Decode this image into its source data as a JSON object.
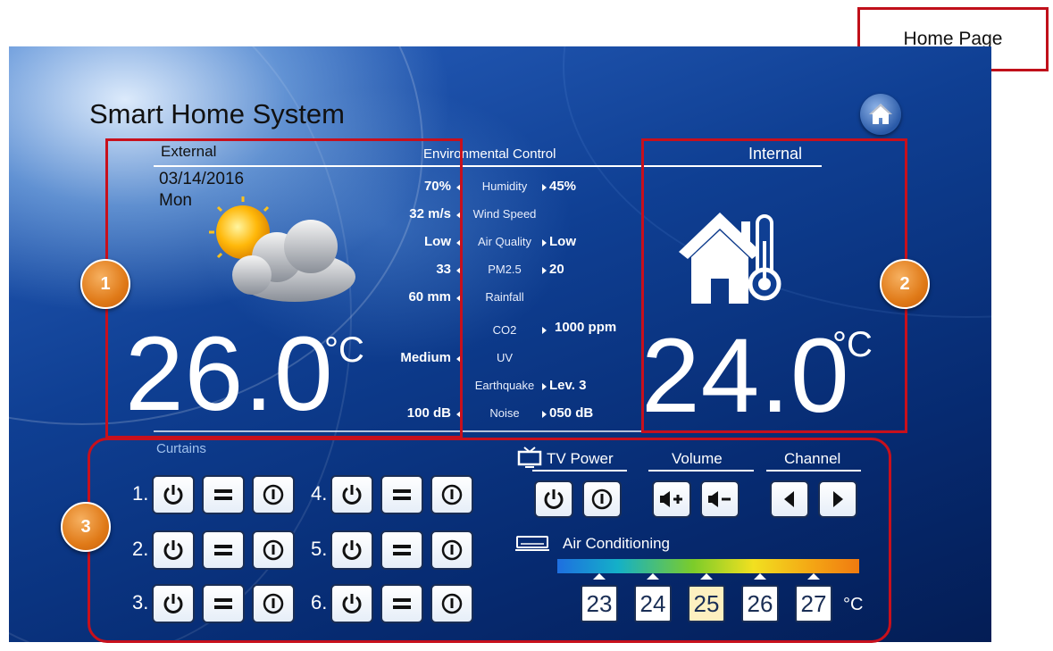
{
  "app": {
    "title": "Smart Home System"
  },
  "callout": {
    "label": "Home Page"
  },
  "external": {
    "label": "External",
    "date": "03/14/2016",
    "day": "Mon",
    "temp": "26.0",
    "unit": "°C"
  },
  "internal": {
    "label": "Internal",
    "temp": "24.0",
    "unit": "°C"
  },
  "environment": {
    "title": "Environmental Control",
    "rows": [
      {
        "label": "Humidity",
        "ext": "70%",
        "int": "45%"
      },
      {
        "label": "Wind Speed",
        "ext": "32 m/s",
        "int": ""
      },
      {
        "label": "Air Quality",
        "ext": "Low",
        "int": "Low"
      },
      {
        "label": "PM2.5",
        "ext": "33",
        "int": "20"
      },
      {
        "label": "Rainfall",
        "ext": "60 mm",
        "int": ""
      },
      {
        "label": "CO2",
        "ext": "",
        "int": "1000 ppm"
      },
      {
        "label": "UV",
        "ext": "Medium",
        "int": ""
      },
      {
        "label": "Earthquake",
        "ext": "",
        "int": "Lev. 3"
      },
      {
        "label": "Noise",
        "ext": "100 dB",
        "int": "050 dB"
      }
    ]
  },
  "badges": [
    "1",
    "2",
    "3"
  ],
  "curtains": {
    "title": "Curtains",
    "numbers": [
      "1.",
      "2.",
      "3.",
      "4.",
      "5.",
      "6."
    ]
  },
  "tv": {
    "power_label": "TV Power",
    "volume_label": "Volume",
    "channel_label": "Channel"
  },
  "ac": {
    "label": "Air Conditioning",
    "temps": [
      "23",
      "24",
      "25",
      "26",
      "27"
    ],
    "selected": "25",
    "unit": "°C"
  },
  "colors": {
    "highlight_box": "#c8101c",
    "badge": "#e07a18",
    "panel": "#0f3f93"
  }
}
